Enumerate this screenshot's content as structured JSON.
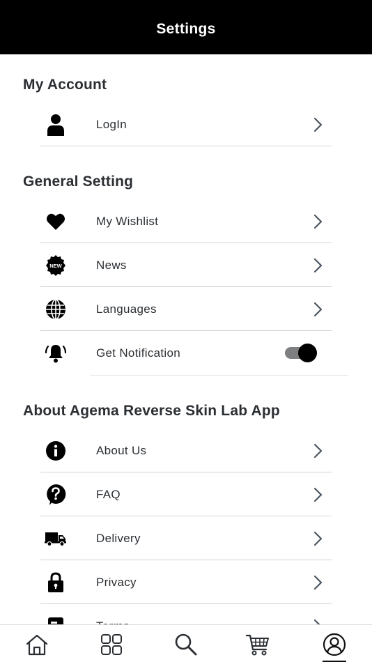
{
  "header": {
    "title": "Settings"
  },
  "sections": {
    "account": {
      "title": "My Account",
      "items": [
        {
          "label": "LogIn",
          "icon": "user-icon"
        }
      ]
    },
    "general": {
      "title": "General Setting",
      "items": [
        {
          "label": "My Wishlist",
          "icon": "heart-icon"
        },
        {
          "label": "News",
          "icon": "new-badge-icon",
          "badge_text": "NEW"
        },
        {
          "label": "Languages",
          "icon": "globe-icon"
        },
        {
          "label": "Get Notification",
          "icon": "bell-ringing-icon",
          "toggle_on": true
        }
      ]
    },
    "about": {
      "title": "About Agema Reverse Skin Lab App",
      "items": [
        {
          "label": "About Us",
          "icon": "info-icon"
        },
        {
          "label": "FAQ",
          "icon": "question-icon"
        },
        {
          "label": "Delivery",
          "icon": "truck-icon"
        },
        {
          "label": "Privacy",
          "icon": "lock-icon"
        },
        {
          "label": "Terms",
          "icon": "document-icon"
        }
      ]
    }
  },
  "tabbar": {
    "items": [
      {
        "icon": "home-icon"
      },
      {
        "icon": "grid-icon"
      },
      {
        "icon": "search-icon"
      },
      {
        "icon": "cart-icon"
      },
      {
        "icon": "profile-icon",
        "active": true
      }
    ]
  },
  "colors": {
    "header_bg": "#000000",
    "text": "#2b2f33",
    "divider": "#cfd2d4",
    "toggle_track": "#7d7f80"
  }
}
